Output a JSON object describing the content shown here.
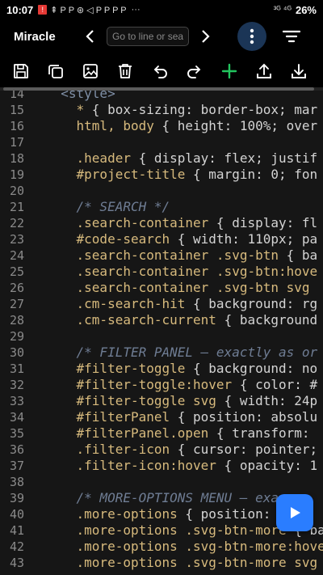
{
  "status_bar": {
    "time": "10:07",
    "notif_icons": "⇞ P P ⊛ ◁ P P P P",
    "more": "···",
    "network": "³ᴳ  ⁴ᴳ",
    "battery": "26%"
  },
  "header": {
    "title": "Miracle",
    "goto_placeholder": "Go to line or sea",
    "prev_icon": "chevron-left-icon",
    "next_icon": "chevron-right-icon",
    "more_icon": "vertical-dots-icon",
    "filter_icon": "filter-lines-icon"
  },
  "toolbar": {
    "icons": [
      "save-icon",
      "copy-icon",
      "image-icon",
      "trash-icon",
      "undo-icon",
      "redo-icon",
      "plus-icon",
      "upload-icon",
      "download-icon"
    ],
    "accent": "#22c55e"
  },
  "editor": {
    "line_numbers": [
      "14",
      "15",
      "16",
      "17",
      "18",
      "19",
      "20",
      "21",
      "22",
      "23",
      "24",
      "25",
      "26",
      "27",
      "28",
      "29",
      "30",
      "31",
      "32",
      "33",
      "34",
      "35",
      "36",
      "37",
      "38",
      "39",
      "40",
      "41",
      "42",
      "43"
    ],
    "lines": [
      {
        "type": "tag",
        "text": "  <style>"
      },
      {
        "type": "code",
        "sel": "    * ",
        "rest": "{ box-sizing: border-box; mar"
      },
      {
        "type": "code",
        "sel": "    html, body ",
        "rest": "{ height: 100%; over"
      },
      {
        "type": "blank",
        "text": ""
      },
      {
        "type": "code",
        "sel": "    .header ",
        "rest": "{ display: flex; justif"
      },
      {
        "type": "code",
        "sel": "    #project-title ",
        "rest": "{ margin: 0; fon"
      },
      {
        "type": "blank",
        "text": ""
      },
      {
        "type": "comment",
        "text": "    /* SEARCH */"
      },
      {
        "type": "code",
        "sel": "    .search-container ",
        "rest": "{ display: fl"
      },
      {
        "type": "code",
        "sel": "    #code-search ",
        "rest": "{ width: 110px; pa"
      },
      {
        "type": "code",
        "sel": "    .search-container .svg-btn ",
        "rest": "{ ba"
      },
      {
        "type": "code",
        "sel": "    .search-container .svg-btn:hove",
        "rest": ""
      },
      {
        "type": "code",
        "sel": "    .search-container .svg-btn svg",
        "rest": ""
      },
      {
        "type": "code",
        "sel": "    .cm-search-hit ",
        "rest": "{ background: rg"
      },
      {
        "type": "code",
        "sel": "    .cm-search-current ",
        "rest": "{ background"
      },
      {
        "type": "blank",
        "text": ""
      },
      {
        "type": "comment",
        "text": "    /* FILTER PANEL — exactly as or"
      },
      {
        "type": "code",
        "sel": "    #filter-toggle ",
        "rest": "{ background: no"
      },
      {
        "type": "code",
        "sel": "    #filter-toggle:hover ",
        "rest": "{ color: #"
      },
      {
        "type": "code",
        "sel": "    #filter-toggle svg ",
        "rest": "{ width: 24p"
      },
      {
        "type": "code",
        "sel": "    #filterPanel ",
        "rest": "{ position: absolu"
      },
      {
        "type": "code",
        "sel": "    #filterPanel.open ",
        "rest": "{ transform:"
      },
      {
        "type": "code",
        "sel": "    .filter-icon ",
        "rest": "{ cursor: pointer;"
      },
      {
        "type": "code",
        "sel": "    .filter-icon:hover ",
        "rest": "{ opacity: 1"
      },
      {
        "type": "blank",
        "text": ""
      },
      {
        "type": "comment",
        "text": "    /* MORE-OPTIONS MENU — exa"
      },
      {
        "type": "code",
        "sel": "    .more-options ",
        "rest": "{ position:"
      },
      {
        "type": "code",
        "sel": "    .more-options .svg-btn-more ",
        "rest": "{ ba"
      },
      {
        "type": "code",
        "sel": "    .more-options .svg-btn-more:hove",
        "rest": ""
      },
      {
        "type": "code",
        "sel": "    .more-options .svg-btn-more svg",
        "rest": ""
      }
    ]
  },
  "fab": {
    "icon": "play-icon",
    "color": "#2a7dff"
  }
}
